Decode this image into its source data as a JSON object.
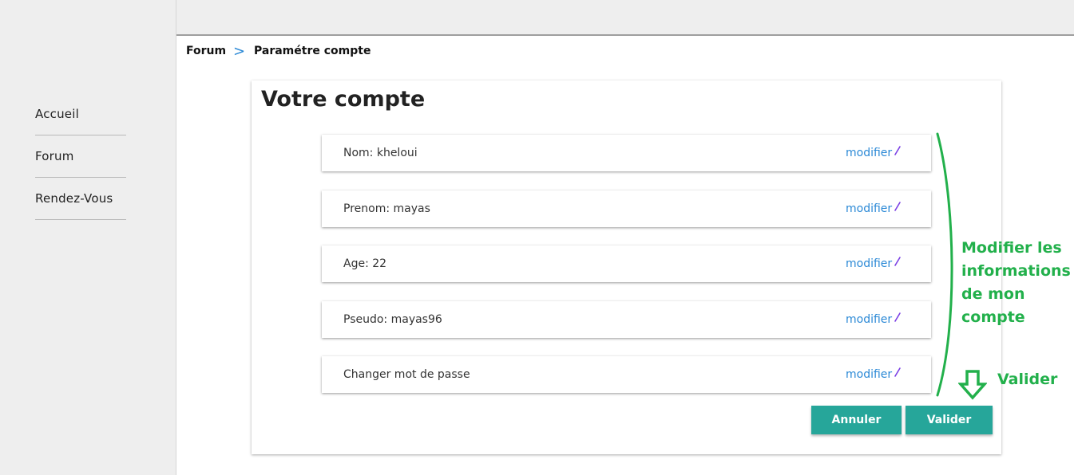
{
  "sidebar": {
    "items": [
      {
        "label": "Accueil"
      },
      {
        "label": "Forum"
      },
      {
        "label": "Rendez-Vous"
      }
    ]
  },
  "breadcrumb": {
    "items": [
      {
        "label": "Forum"
      },
      {
        "label": "Paramétre compte"
      }
    ],
    "separator": ">"
  },
  "main": {
    "title": "Votre compte",
    "rows": [
      {
        "label": "Nom: kheloui",
        "action": "modifier"
      },
      {
        "label": "Prenom: mayas",
        "action": "modifier"
      },
      {
        "label": "Age: 22",
        "action": "modifier"
      },
      {
        "label": "Pseudo: mayas96",
        "action": "modifier"
      },
      {
        "label": "Changer mot de passe",
        "action": "modifier"
      }
    ],
    "cancel_label": "Annuler",
    "validate_label": "Valider"
  },
  "annotations": {
    "bracket_text": [
      "Modifier les",
      "informations",
      "de mon",
      "compte"
    ],
    "arrow_text": "Valider"
  },
  "colors": {
    "accent": "#26a69a",
    "link": "#2b89d6",
    "annotation": "#22b04b",
    "pencil": "#7b3fe4"
  }
}
